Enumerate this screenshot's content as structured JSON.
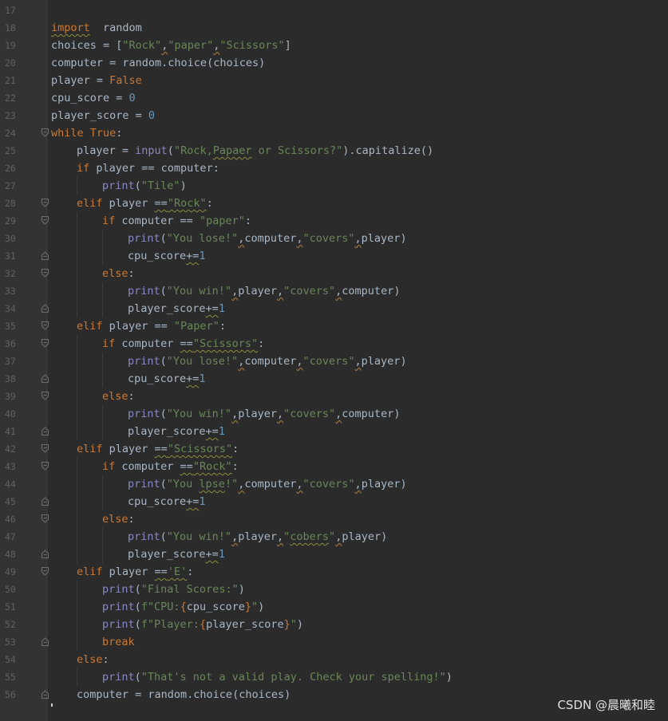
{
  "editor": {
    "lines": [
      {
        "n": "17",
        "indent": 0,
        "fold": "",
        "tokens": []
      },
      {
        "n": "18",
        "indent": 0,
        "fold": "",
        "tokens": [
          [
            "kw w",
            "import"
          ],
          [
            "",
            "  random"
          ]
        ]
      },
      {
        "n": "19",
        "indent": 0,
        "fold": "",
        "tokens": [
          [
            "",
            "choices = ["
          ],
          [
            "str",
            "\"Rock\""
          ],
          [
            "cw",
            ","
          ],
          [
            "str",
            "\"paper\""
          ],
          [
            "cw",
            ","
          ],
          [
            "str",
            "\"Scissors\""
          ],
          [
            "",
            "]"
          ]
        ]
      },
      {
        "n": "20",
        "indent": 0,
        "fold": "",
        "tokens": [
          [
            "",
            "computer = random.choice(choices)"
          ]
        ]
      },
      {
        "n": "21",
        "indent": 0,
        "fold": "",
        "tokens": [
          [
            "",
            "player = "
          ],
          [
            "kw",
            "False"
          ]
        ]
      },
      {
        "n": "22",
        "indent": 0,
        "fold": "",
        "tokens": [
          [
            "",
            "cpu_score = "
          ],
          [
            "num",
            "0"
          ]
        ]
      },
      {
        "n": "23",
        "indent": 0,
        "fold": "",
        "tokens": [
          [
            "",
            "player_score = "
          ],
          [
            "num",
            "0"
          ]
        ]
      },
      {
        "n": "24",
        "indent": 0,
        "fold": "open",
        "tokens": [
          [
            "kw",
            "while"
          ],
          [
            "",
            " "
          ],
          [
            "kw",
            "True"
          ],
          [
            "",
            ":"
          ]
        ]
      },
      {
        "n": "25",
        "indent": 1,
        "fold": "",
        "tokens": [
          [
            "",
            "player = "
          ],
          [
            "bi",
            "input"
          ],
          [
            "",
            "("
          ],
          [
            "str",
            "\"Rock,"
          ],
          [
            "str w",
            "Papaer"
          ],
          [
            "str",
            " or Scissors?\""
          ],
          [
            "",
            ").capitalize()"
          ]
        ]
      },
      {
        "n": "26",
        "indent": 1,
        "fold": "",
        "tokens": [
          [
            "kw",
            "if"
          ],
          [
            "",
            " player == computer:"
          ]
        ]
      },
      {
        "n": "27",
        "indent": 2,
        "fold": "",
        "tokens": [
          [
            "bi",
            "print"
          ],
          [
            "",
            "("
          ],
          [
            "str",
            "\"Tile\""
          ],
          [
            "",
            ")"
          ]
        ]
      },
      {
        "n": "28",
        "indent": 1,
        "fold": "open",
        "tokens": [
          [
            "kw",
            "elif"
          ],
          [
            "",
            " player "
          ],
          [
            "w",
            "=="
          ],
          [
            "str w",
            "\"Rock\""
          ],
          [
            "",
            ":"
          ]
        ]
      },
      {
        "n": "29",
        "indent": 2,
        "fold": "open",
        "tokens": [
          [
            "kw",
            "if"
          ],
          [
            "",
            " computer == "
          ],
          [
            "str",
            "\"paper\""
          ],
          [
            "",
            ":"
          ]
        ]
      },
      {
        "n": "30",
        "indent": 3,
        "fold": "",
        "tokens": [
          [
            "bi",
            "print"
          ],
          [
            "",
            "("
          ],
          [
            "str",
            "\"You lose!\""
          ],
          [
            "cw",
            ","
          ],
          [
            "",
            "computer"
          ],
          [
            "cw",
            ","
          ],
          [
            "str",
            "\"covers\""
          ],
          [
            "cw",
            ","
          ],
          [
            "",
            "player)"
          ]
        ]
      },
      {
        "n": "31",
        "indent": 3,
        "fold": "close",
        "tokens": [
          [
            "",
            "cpu_score"
          ],
          [
            "w",
            "+="
          ],
          [
            "num",
            "1"
          ]
        ]
      },
      {
        "n": "32",
        "indent": 2,
        "fold": "open",
        "tokens": [
          [
            "kw",
            "else"
          ],
          [
            "",
            ":"
          ]
        ]
      },
      {
        "n": "33",
        "indent": 3,
        "fold": "",
        "tokens": [
          [
            "bi",
            "print"
          ],
          [
            "",
            "("
          ],
          [
            "str",
            "\"You win!\""
          ],
          [
            "cw",
            ","
          ],
          [
            "",
            "player"
          ],
          [
            "cw",
            ","
          ],
          [
            "str",
            "\"covers\""
          ],
          [
            "cw",
            ","
          ],
          [
            "",
            "computer)"
          ]
        ]
      },
      {
        "n": "34",
        "indent": 3,
        "fold": "close",
        "tokens": [
          [
            "",
            "player_score"
          ],
          [
            "w",
            "+="
          ],
          [
            "num",
            "1"
          ]
        ]
      },
      {
        "n": "35",
        "indent": 1,
        "fold": "open",
        "tokens": [
          [
            "kw",
            "elif"
          ],
          [
            "",
            " player == "
          ],
          [
            "str",
            "\"Paper\""
          ],
          [
            "",
            ":"
          ]
        ]
      },
      {
        "n": "36",
        "indent": 2,
        "fold": "open",
        "tokens": [
          [
            "kw",
            "if"
          ],
          [
            "",
            " computer "
          ],
          [
            "w",
            "=="
          ],
          [
            "str w",
            "\"Scissors\""
          ],
          [
            "",
            ":"
          ]
        ]
      },
      {
        "n": "37",
        "indent": 3,
        "fold": "",
        "tokens": [
          [
            "bi",
            "print"
          ],
          [
            "",
            "("
          ],
          [
            "str",
            "\"You lose!\""
          ],
          [
            "cw",
            ","
          ],
          [
            "",
            "computer"
          ],
          [
            "cw",
            ","
          ],
          [
            "str",
            "\"covers\""
          ],
          [
            "cw",
            ","
          ],
          [
            "",
            "player)"
          ]
        ]
      },
      {
        "n": "38",
        "indent": 3,
        "fold": "close",
        "tokens": [
          [
            "",
            "cpu_score"
          ],
          [
            "w",
            "+="
          ],
          [
            "num",
            "1"
          ]
        ]
      },
      {
        "n": "39",
        "indent": 2,
        "fold": "open",
        "tokens": [
          [
            "kw",
            "else"
          ],
          [
            "",
            ":"
          ]
        ]
      },
      {
        "n": "40",
        "indent": 3,
        "fold": "",
        "tokens": [
          [
            "bi",
            "print"
          ],
          [
            "",
            "("
          ],
          [
            "str",
            "\"You win!\""
          ],
          [
            "cw",
            ","
          ],
          [
            "",
            "player"
          ],
          [
            "cw",
            ","
          ],
          [
            "str",
            "\"covers\""
          ],
          [
            "cw",
            ","
          ],
          [
            "",
            "computer)"
          ]
        ]
      },
      {
        "n": "41",
        "indent": 3,
        "fold": "close",
        "tokens": [
          [
            "",
            "player_score"
          ],
          [
            "w",
            "+="
          ],
          [
            "num",
            "1"
          ]
        ]
      },
      {
        "n": "42",
        "indent": 1,
        "fold": "open",
        "tokens": [
          [
            "kw",
            "elif"
          ],
          [
            "",
            " player "
          ],
          [
            "w",
            "=="
          ],
          [
            "str w",
            "\"Scissors\""
          ],
          [
            "",
            ":"
          ]
        ]
      },
      {
        "n": "43",
        "indent": 2,
        "fold": "open",
        "tokens": [
          [
            "kw",
            "if"
          ],
          [
            "",
            " computer "
          ],
          [
            "w",
            "=="
          ],
          [
            "str w",
            "\"Rock\""
          ],
          [
            "",
            ":"
          ]
        ]
      },
      {
        "n": "44",
        "indent": 3,
        "fold": "",
        "tokens": [
          [
            "bi",
            "print"
          ],
          [
            "",
            "("
          ],
          [
            "str",
            "\"You "
          ],
          [
            "str w",
            "lpse"
          ],
          [
            "str",
            "!\""
          ],
          [
            "cw",
            ","
          ],
          [
            "",
            "computer"
          ],
          [
            "cw",
            ","
          ],
          [
            "str",
            "\"covers\""
          ],
          [
            "cw",
            ","
          ],
          [
            "",
            "player)"
          ]
        ]
      },
      {
        "n": "45",
        "indent": 3,
        "fold": "close",
        "tokens": [
          [
            "",
            "cpu_score"
          ],
          [
            "w",
            "+="
          ],
          [
            "num",
            "1"
          ]
        ]
      },
      {
        "n": "46",
        "indent": 2,
        "fold": "open",
        "tokens": [
          [
            "kw",
            "else"
          ],
          [
            "",
            ":"
          ]
        ]
      },
      {
        "n": "47",
        "indent": 3,
        "fold": "",
        "tokens": [
          [
            "bi",
            "print"
          ],
          [
            "",
            "("
          ],
          [
            "str",
            "\"You win!\""
          ],
          [
            "cw",
            ","
          ],
          [
            "",
            "player"
          ],
          [
            "cw",
            ","
          ],
          [
            "str",
            "\""
          ],
          [
            "str w",
            "cobers"
          ],
          [
            "str",
            "\""
          ],
          [
            "cw",
            ","
          ],
          [
            "",
            "player)"
          ]
        ]
      },
      {
        "n": "48",
        "indent": 3,
        "fold": "close",
        "tokens": [
          [
            "",
            "player_score"
          ],
          [
            "w",
            "+="
          ],
          [
            "num",
            "1"
          ]
        ]
      },
      {
        "n": "49",
        "indent": 1,
        "fold": "open",
        "tokens": [
          [
            "kw",
            "elif"
          ],
          [
            "",
            " player "
          ],
          [
            "w",
            "=="
          ],
          [
            "str w",
            "'E'"
          ],
          [
            "",
            ":"
          ]
        ]
      },
      {
        "n": "50",
        "indent": 2,
        "fold": "",
        "tokens": [
          [
            "bi",
            "print"
          ],
          [
            "",
            "("
          ],
          [
            "str",
            "\"Final Scores:\""
          ],
          [
            "",
            ")"
          ]
        ]
      },
      {
        "n": "51",
        "indent": 2,
        "fold": "",
        "tokens": [
          [
            "bi",
            "print"
          ],
          [
            "",
            "("
          ],
          [
            "str",
            "f\"CPU:"
          ],
          [
            "kw",
            "{"
          ],
          [
            "",
            "cpu_score"
          ],
          [
            "kw",
            "}"
          ],
          [
            "str",
            "\""
          ],
          [
            "",
            ")"
          ]
        ]
      },
      {
        "n": "52",
        "indent": 2,
        "fold": "",
        "tokens": [
          [
            "bi",
            "print"
          ],
          [
            "",
            "("
          ],
          [
            "str",
            "f\"Player:"
          ],
          [
            "kw",
            "{"
          ],
          [
            "",
            "player_score"
          ],
          [
            "kw",
            "}"
          ],
          [
            "str",
            "\""
          ],
          [
            "",
            ")"
          ]
        ]
      },
      {
        "n": "53",
        "indent": 2,
        "fold": "close",
        "tokens": [
          [
            "kw",
            "break"
          ]
        ]
      },
      {
        "n": "54",
        "indent": 1,
        "fold": "",
        "tokens": [
          [
            "kw",
            "else"
          ],
          [
            "",
            ":"
          ]
        ]
      },
      {
        "n": "55",
        "indent": 2,
        "fold": "",
        "tokens": [
          [
            "bi",
            "print"
          ],
          [
            "",
            "("
          ],
          [
            "str",
            "\"That's not a valid play. Check your spelling!\""
          ],
          [
            "",
            ")"
          ]
        ]
      },
      {
        "n": "56",
        "indent": 1,
        "fold": "close",
        "tokens": [
          [
            "",
            "computer = random.choice(choices)"
          ]
        ]
      }
    ]
  },
  "watermark": {
    "text": "CSDN @晨曦和睦"
  },
  "colors": {
    "background": "#2b2b2b",
    "gutter": "#313335",
    "keyword": "#cc7832",
    "string": "#6a8759",
    "number": "#6897bb",
    "builtin": "#8888c6"
  }
}
